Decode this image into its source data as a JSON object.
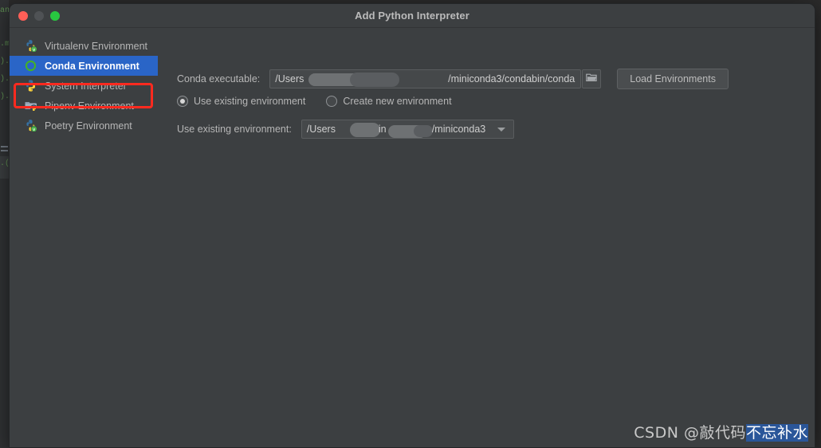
{
  "window": {
    "title": "Add Python Interpreter",
    "traffic_lights": [
      {
        "name": "close",
        "color": "#ff5f57"
      },
      {
        "name": "minimize",
        "color": "#4f5255"
      },
      {
        "name": "zoom",
        "color": "#28c840"
      }
    ]
  },
  "sidebar": {
    "items": [
      {
        "label": "Virtualenv Environment",
        "icon": "python-venv-icon",
        "selected": false
      },
      {
        "label": "Conda Environment",
        "icon": "conda-icon",
        "selected": true
      },
      {
        "label": "System Interpreter",
        "icon": "python-icon",
        "selected": false
      },
      {
        "label": "Pipenv Environment",
        "icon": "pipenv-folder-icon",
        "selected": false
      },
      {
        "label": "Poetry Environment",
        "icon": "python-poetry-icon",
        "selected": false
      }
    ],
    "selected_index": 1,
    "selection_color": "#2a65c7",
    "annotation_color": "#ff2a1f"
  },
  "form": {
    "conda_executable": {
      "label": "Conda executable:",
      "value_prefix": "/Users",
      "value_suffix": "/miniconda3/condabin/conda",
      "redacted": true,
      "browse_icon": "folder-icon"
    },
    "load_button": {
      "label": "Load Environments"
    },
    "radios": [
      {
        "label": "Use existing environment",
        "selected": true
      },
      {
        "label": "Create new environment",
        "selected": false
      }
    ],
    "existing_environment": {
      "label": "Use existing environment:",
      "value_prefix": "/Users",
      "value_mid": "in",
      "value_suffix": "/miniconda3",
      "redacted": true,
      "dropdown_icon": "chevron-down-icon"
    }
  },
  "watermark": {
    "prefix": "CSDN @敲代码",
    "highlighted": "不忘补水"
  },
  "theme": {
    "dialog_bg": "#3c3f41",
    "field_bg": "#45484a",
    "text": "#b6b6b6",
    "accent": "#2a65c7"
  }
}
